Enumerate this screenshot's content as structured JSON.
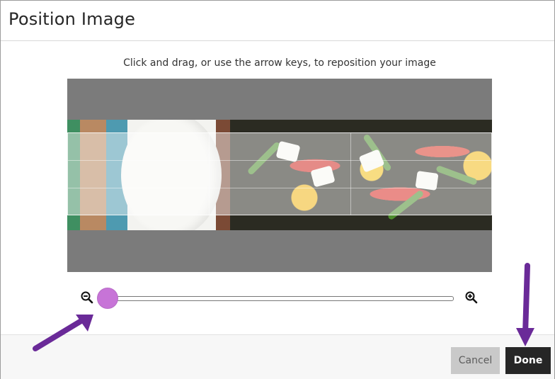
{
  "dialog": {
    "title": "Position Image",
    "instruction": "Click and drag, or use the arrow keys, to reposition your image"
  },
  "editor": {
    "image_subject": "salad image",
    "zoom_level": 0
  },
  "controls": {
    "zoom_out_icon": "zoom-out-icon",
    "zoom_in_icon": "zoom-in-icon"
  },
  "footer": {
    "cancel_label": "Cancel",
    "done_label": "Done"
  },
  "colors": {
    "slider_thumb": "#c774d7",
    "annotation_arrow": "#6a2a98",
    "done_button": "#262626",
    "cancel_button": "#c9c9c9"
  }
}
